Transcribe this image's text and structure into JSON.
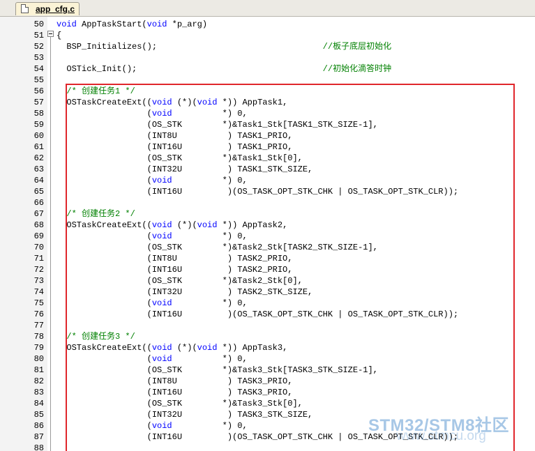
{
  "tab": {
    "label": "app_cfg.c"
  },
  "colors": {
    "keyword": "#0000ff",
    "comment": "#008000",
    "highlight_border": "#e0262b",
    "tab_bg": "#fbf3d6"
  },
  "watermark": {
    "text": "STM32/STM8社区",
    "url": "www.stmcu.org"
  },
  "lines": [
    {
      "n": "50",
      "segs": [
        {
          "t": "void",
          "c": "kw"
        },
        {
          "t": " AppTaskStart("
        },
        {
          "t": "void",
          "c": "kw"
        },
        {
          "t": " *p_arg)"
        }
      ]
    },
    {
      "n": "51",
      "segs": [
        {
          "t": "{"
        }
      ]
    },
    {
      "n": "52",
      "segs": [
        {
          "t": "  BSP_Initializes();                                 "
        },
        {
          "t": "//板子底层初始化",
          "c": "cm"
        }
      ]
    },
    {
      "n": "53",
      "segs": []
    },
    {
      "n": "54",
      "segs": [
        {
          "t": "  OSTick_Init();                                     "
        },
        {
          "t": "//初始化滴答时钟",
          "c": "cm"
        }
      ]
    },
    {
      "n": "55",
      "segs": []
    },
    {
      "n": "56",
      "segs": [
        {
          "t": "  "
        },
        {
          "t": "/* 创建任务1 */",
          "c": "cm"
        }
      ]
    },
    {
      "n": "57",
      "segs": [
        {
          "t": "  OSTaskCreateExt(("
        },
        {
          "t": "void",
          "c": "kw"
        },
        {
          "t": " (*)("
        },
        {
          "t": "void",
          "c": "kw"
        },
        {
          "t": " *)) AppTask1,"
        }
      ]
    },
    {
      "n": "58",
      "segs": [
        {
          "t": "                  ("
        },
        {
          "t": "void",
          "c": "kw"
        },
        {
          "t": "          *) 0,"
        }
      ]
    },
    {
      "n": "59",
      "segs": [
        {
          "t": "                  (OS_STK        *)&Task1_Stk[TASK1_STK_SIZE-1],"
        }
      ]
    },
    {
      "n": "60",
      "segs": [
        {
          "t": "                  (INT8U          ) TASK1_PRIO,"
        }
      ]
    },
    {
      "n": "61",
      "segs": [
        {
          "t": "                  (INT16U         ) TASK1_PRIO,"
        }
      ]
    },
    {
      "n": "62",
      "segs": [
        {
          "t": "                  (OS_STK        *)&Task1_Stk[0],"
        }
      ]
    },
    {
      "n": "63",
      "segs": [
        {
          "t": "                  (INT32U         ) TASK1_STK_SIZE,"
        }
      ]
    },
    {
      "n": "64",
      "segs": [
        {
          "t": "                  ("
        },
        {
          "t": "void",
          "c": "kw"
        },
        {
          "t": "          *) 0,"
        }
      ]
    },
    {
      "n": "65",
      "segs": [
        {
          "t": "                  (INT16U         )(OS_TASK_OPT_STK_CHK | OS_TASK_OPT_STK_CLR));"
        }
      ]
    },
    {
      "n": "66",
      "segs": []
    },
    {
      "n": "67",
      "segs": [
        {
          "t": "  "
        },
        {
          "t": "/* 创建任务2 */",
          "c": "cm"
        }
      ]
    },
    {
      "n": "68",
      "segs": [
        {
          "t": "  OSTaskCreateExt(("
        },
        {
          "t": "void",
          "c": "kw"
        },
        {
          "t": " (*)("
        },
        {
          "t": "void",
          "c": "kw"
        },
        {
          "t": " *)) AppTask2,"
        }
      ]
    },
    {
      "n": "69",
      "segs": [
        {
          "t": "                  ("
        },
        {
          "t": "void",
          "c": "kw"
        },
        {
          "t": "          *) 0,"
        }
      ]
    },
    {
      "n": "70",
      "segs": [
        {
          "t": "                  (OS_STK        *)&Task2_Stk[TASK2_STK_SIZE-1],"
        }
      ]
    },
    {
      "n": "71",
      "segs": [
        {
          "t": "                  (INT8U          ) TASK2_PRIO,"
        }
      ]
    },
    {
      "n": "72",
      "segs": [
        {
          "t": "                  (INT16U         ) TASK2_PRIO,"
        }
      ]
    },
    {
      "n": "73",
      "segs": [
        {
          "t": "                  (OS_STK        *)&Task2_Stk[0],"
        }
      ]
    },
    {
      "n": "74",
      "segs": [
        {
          "t": "                  (INT32U         ) TASK2_STK_SIZE,"
        }
      ]
    },
    {
      "n": "75",
      "segs": [
        {
          "t": "                  ("
        },
        {
          "t": "void",
          "c": "kw"
        },
        {
          "t": "          *) 0,"
        }
      ]
    },
    {
      "n": "76",
      "segs": [
        {
          "t": "                  (INT16U         )(OS_TASK_OPT_STK_CHK | OS_TASK_OPT_STK_CLR));"
        }
      ]
    },
    {
      "n": "77",
      "segs": []
    },
    {
      "n": "78",
      "segs": [
        {
          "t": "  "
        },
        {
          "t": "/* 创建任务3 */",
          "c": "cm"
        }
      ]
    },
    {
      "n": "79",
      "segs": [
        {
          "t": "  OSTaskCreateExt(("
        },
        {
          "t": "void",
          "c": "kw"
        },
        {
          "t": " (*)("
        },
        {
          "t": "void",
          "c": "kw"
        },
        {
          "t": " *)) AppTask3,"
        }
      ]
    },
    {
      "n": "80",
      "segs": [
        {
          "t": "                  ("
        },
        {
          "t": "void",
          "c": "kw"
        },
        {
          "t": "          *) 0,"
        }
      ]
    },
    {
      "n": "81",
      "segs": [
        {
          "t": "                  (OS_STK        *)&Task3_Stk[TASK3_STK_SIZE-1],"
        }
      ]
    },
    {
      "n": "82",
      "segs": [
        {
          "t": "                  (INT8U          ) TASK3_PRIO,"
        }
      ]
    },
    {
      "n": "83",
      "segs": [
        {
          "t": "                  (INT16U         ) TASK3_PRIO,"
        }
      ]
    },
    {
      "n": "84",
      "segs": [
        {
          "t": "                  (OS_STK        *)&Task3_Stk[0],"
        }
      ]
    },
    {
      "n": "85",
      "segs": [
        {
          "t": "                  (INT32U         ) TASK3_STK_SIZE,"
        }
      ]
    },
    {
      "n": "86",
      "segs": [
        {
          "t": "                  ("
        },
        {
          "t": "void",
          "c": "kw"
        },
        {
          "t": "          *) 0,"
        }
      ]
    },
    {
      "n": "87",
      "segs": [
        {
          "t": "                  (INT16U         )(OS_TASK_OPT_STK_CHK | OS_TASK_OPT_STK_CLR));"
        }
      ]
    },
    {
      "n": "88",
      "segs": []
    }
  ]
}
